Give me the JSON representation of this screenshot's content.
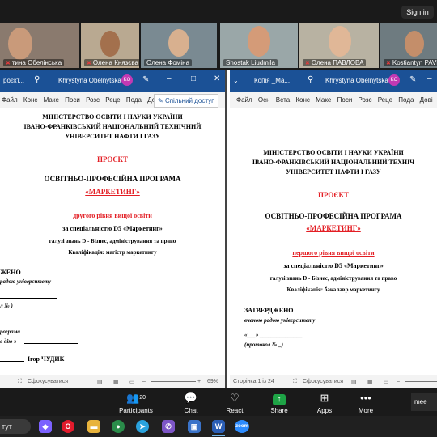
{
  "meeting": {
    "sign_in": "Sign in",
    "participants": [
      {
        "name": "тина Обелiнська",
        "muted": true
      },
      {
        "name": "Олена Князєва",
        "muted": true
      },
      {
        "name": "Олена Фоміна",
        "muted": false
      },
      {
        "name": "Shostak Liudmila",
        "muted": false
      },
      {
        "name": "Олена ПАВЛОВА",
        "muted": true
      },
      {
        "name": "Kostiantyn PAVL",
        "muted": true
      }
    ],
    "toolbar": {
      "participants_label": "Participants",
      "participants_count": "20",
      "chat_label": "Chat",
      "react_label": "React",
      "share_label": "Share",
      "apps_label": "Apps",
      "more_label": "More",
      "mee_label": "mee"
    }
  },
  "left_window": {
    "title": "роєкт...",
    "user": "Khrystyna Obelnytska",
    "avatar": "KO",
    "ribbon_tabs": [
      "Файл",
      "Конс",
      "Маке",
      "Поси",
      "Розс",
      "Реце",
      "Пода",
      "Довід"
    ],
    "share": "Спільний доступ",
    "doc": {
      "ministry": "МІНІСТЕРСТВО ОСВІТИ І НАУКИ УКРАЇНИ",
      "university1": "ІВАНО-ФРАНКІВСЬКИЙ НАЦІОНАЛЬНИЙ ТЕХНІЧНИЙ",
      "university2": "УНІВЕРСИТЕТ НАФТИ І ГАЗУ",
      "project": "ПРОЄКТ",
      "program": "ОСВІТНЬО-ПРОФЕСІЙНА ПРОГРАМА",
      "program_name": "«МАРКЕТИНГ»",
      "level": "другого рівня вищої освіти",
      "specialty": "за спеціальністю D5 «Маркетинг»",
      "field": "галузі знань D - Бізнес, адміністрування та право",
      "qualification": "Кваліфікація: магістр маркетингу",
      "approved": "ЖЕНО",
      "council": "радою університету",
      "protocol": "л №  )",
      "program2": "рограма",
      "enacted": "в дію з",
      "rector": "Ігор ЧУДИК"
    },
    "status_focus": "Сфокусуватися",
    "zoom": "69%"
  },
  "right_window": {
    "title": "Копія _Ма...",
    "user": "Khrystyna Obelnytska",
    "avatar": "KO",
    "ribbon_tabs": [
      "Файл",
      "Осн",
      "Вста",
      "Конс",
      "Маке",
      "Поси",
      "Розс",
      "Реце",
      "Пода",
      "Дові"
    ],
    "doc": {
      "ministry": "МІНІСТЕРСТВО ОСВІТИ І НАУКИ УКРАЇНИ",
      "university1": "ІВАНО-ФРАНКІВСЬКИЙ НАЦІОНАЛЬНИЙ ТЕХНІЧ",
      "university2": "УНІВЕРСИТЕТ НАФТИ І ГАЗУ",
      "project": "ПРОЄКТ",
      "program": "ОСВІТНЬО-ПРОФЕСІЙНА ПРОГРАМА",
      "program_name": "«МАРКЕТИНГ»",
      "level": "першого рівня вищої освіти",
      "specialty": "за спеціальністю D5 «Маркетинг»",
      "field": "галузі знань D - Бізнес, адміністрування та право",
      "qualification": "Кваліфікація: бакалавр маркетингу",
      "approved": "ЗАТВЕРДЖЕНО",
      "council": "вченою радою університету",
      "date_line": "«___» _______________",
      "protocol": "(протокол №  _)"
    },
    "status_page": "Сторінка 1 із 24",
    "status_focus": "Сфокусуватися"
  },
  "taskbar": {
    "search_text": "тут",
    "apps": [
      {
        "icon": "copilot-icon",
        "color": "#7b61ff",
        "glyph": "◆"
      },
      {
        "icon": "opera-icon",
        "color": "#e21b2c",
        "glyph": "O"
      },
      {
        "icon": "folder-icon",
        "color": "#e8b33c",
        "glyph": "▬"
      },
      {
        "icon": "chrome-icon",
        "color": "#2a8c4a",
        "glyph": "●"
      },
      {
        "icon": "telegram-icon",
        "color": "#2aa3de",
        "glyph": "➤"
      },
      {
        "icon": "viber-icon",
        "color": "#7d55c7",
        "glyph": "✆"
      },
      {
        "icon": "photos-icon",
        "color": "#3a73c9",
        "glyph": "▣"
      },
      {
        "icon": "word-icon",
        "color": "#2b5eb5",
        "glyph": "W"
      },
      {
        "icon": "zoom-icon",
        "color": "#2d8cff",
        "glyph": "zoom"
      }
    ]
  }
}
